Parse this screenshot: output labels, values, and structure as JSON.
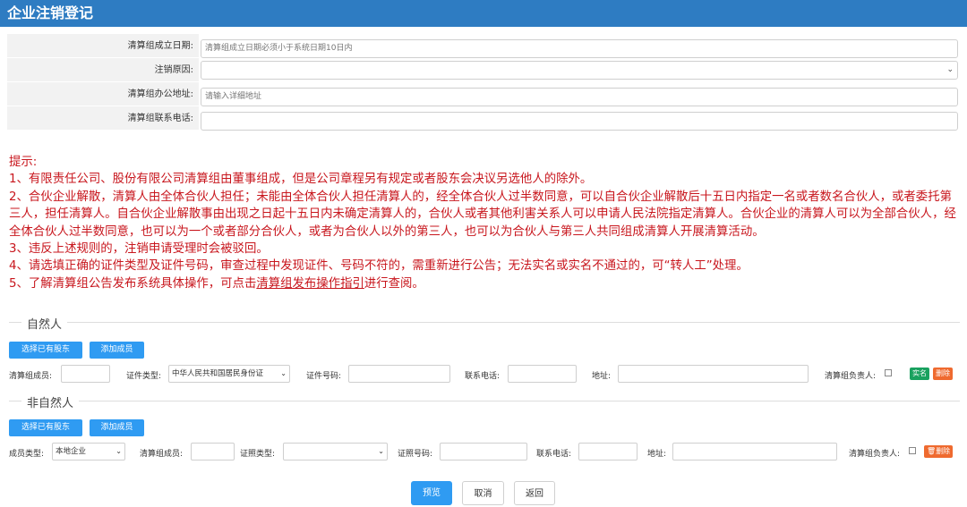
{
  "page": {
    "title": "企业注销登记"
  },
  "form": {
    "setup_date_label": "清算组成立日期:",
    "setup_date_placeholder": "清算组成立日期必须小于系统日期10日内",
    "reason_label": "注销原因:",
    "reason_value": "",
    "address_label": "清算组办公地址:",
    "address_placeholder": "请输入详细地址",
    "phone_label": "清算组联系电话:",
    "phone_value": ""
  },
  "tips": {
    "heading": "提示:",
    "items": [
      "1、有限责任公司、股份有限公司清算组由董事组成，但是公司章程另有规定或者股东会决议另选他人的除外。",
      "2、合伙企业解散，清算人由全体合伙人担任；未能由全体合伙人担任清算人的，经全体合伙人过半数同意，可以自合伙企业解散后十五日内指定一名或者数名合伙人，或者委托第三人，担任清算人。自合伙企业解散事由出现之日起十五日内未确定清算人的，合伙人或者其他利害关系人可以申请人民法院指定清算人。合伙企业的清算人可以为全部合伙人，经全体合伙人过半数同意，也可以为一个或者部分合伙人，或者为合伙人以外的第三人，也可以为合伙人与第三人共同组成清算人开展清算活动。",
      "3、违反上述规则的，注销申请受理时会被驳回。",
      "4、请选填正确的证件类型及证件号码，审查过程中发现证件、号码不符的，需重新进行公告；无法实名或实名不通过的，可“转人工”处理。"
    ],
    "item5_prefix": "5、了解清算组公告发布系统具体操作，可点击",
    "item5_link": "清算组发布操作指引",
    "item5_suffix": "进行查阅。"
  },
  "natural": {
    "section_title": "自然人",
    "select_shareholder": "选择已有股东",
    "add_member": "添加成员",
    "member_label": "清算组成员:",
    "member_value": "",
    "id_type_label": "证件类型:",
    "id_type_value": "中华人民共和国居民身份证",
    "id_number_label": "证件号码:",
    "id_number_value": "",
    "phone_label": "联系电话:",
    "phone_value": "",
    "address_label": "地址:",
    "address_value": "",
    "leader_label": "清算组负责人:",
    "verify_btn": "实名",
    "delete_btn": "删除"
  },
  "non_natural": {
    "section_title": "非自然人",
    "select_shareholder": "选择已有股东",
    "add_member": "添加成员",
    "member_type_label": "成员类型:",
    "member_type_value": "本地企业",
    "member_label": "清算组成员:",
    "member_value": "",
    "license_type_label": "证照类型:",
    "license_type_value": "",
    "license_number_label": "证照号码:",
    "license_number_value": "",
    "phone_label": "联系电话:",
    "phone_value": "",
    "address_label": "地址:",
    "address_value": "",
    "leader_label": "清算组负责人:",
    "delete_btn": "删除"
  },
  "footer": {
    "preview": "预览",
    "cancel": "取消",
    "back": "返回"
  },
  "colors": {
    "title_bg": "#2e7cc2",
    "tips_red": "#c8161d",
    "button_blue": "#2f9bf2",
    "verify_green": "#19a15f",
    "delete_orange": "#ef6a2f"
  }
}
